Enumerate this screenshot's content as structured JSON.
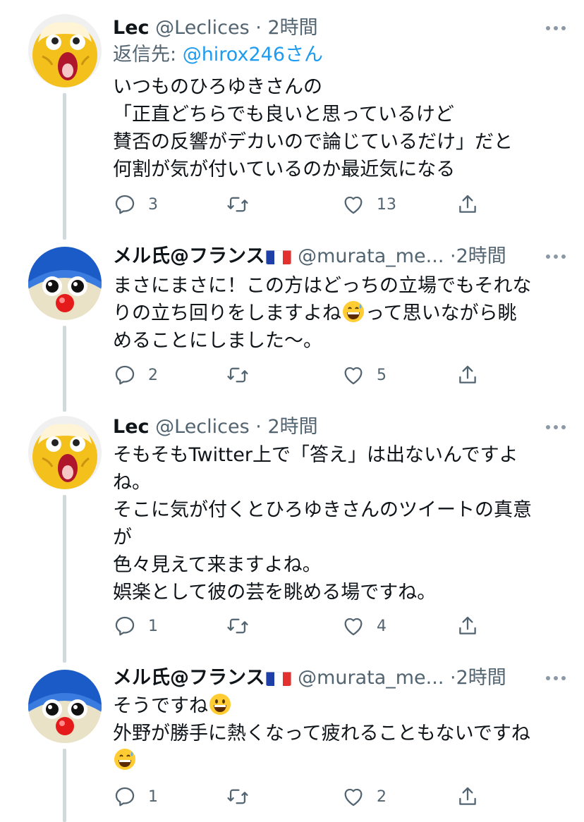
{
  "tweets": [
    {
      "name": "Lec",
      "handle": "@Leclices",
      "dot": "·",
      "time": "2時間",
      "reply_prefix": "返信先: ",
      "reply_to": "@hirox246さん",
      "lines": [
        "いつものひろゆきさんの",
        "「正直どちらでも良いと思っているけど",
        "賛否の反響がデカいので論じているだけ」だと",
        "何割が気が付いているのか最近気になる"
      ],
      "reply_count": "3",
      "retweet_count": "",
      "like_count": "13"
    },
    {
      "name": "メル氏@フランス",
      "handle": "@murata_me...",
      "dot": "·",
      "time": "2時間",
      "lines": [
        "まさにまさに！この方はどっちの立場でもそれな",
        "りの立ち回りをしますよね",
        "って思いながら眺",
        "めることにしました〜。"
      ],
      "reply_count": "2",
      "retweet_count": "",
      "like_count": "5"
    },
    {
      "name": "Lec",
      "handle": "@Leclices",
      "dot": "·",
      "time": "2時間",
      "lines": [
        "そもそもTwitter上で「答え」は出ないんですよ",
        "ね。",
        "そこに気が付くとひろゆきさんのツイートの真意",
        "が",
        "色々見えて来ますよね。",
        "娯楽として彼の芸を眺める場ですね。"
      ],
      "reply_count": "1",
      "retweet_count": "",
      "like_count": "4"
    },
    {
      "name": "メル氏@フランス",
      "handle": "@murata_me...",
      "dot": "·",
      "time": "2時間",
      "lines": [
        "そうですね",
        "外野が勝手に熱くなって疲れることもないですね"
      ],
      "reply_count": "1",
      "retweet_count": "",
      "like_count": "2"
    }
  ],
  "emoji_names": [
    "grinning-sweat-emoji",
    "smiling-emoji"
  ],
  "icons": [
    "reply-icon",
    "retweet-icon",
    "like-icon",
    "share-icon",
    "more-icon",
    "france-flag-icon"
  ],
  "colors": {
    "link": "#1d9bf0",
    "secondary": "#536471",
    "thread_line": "#cfd9de"
  }
}
